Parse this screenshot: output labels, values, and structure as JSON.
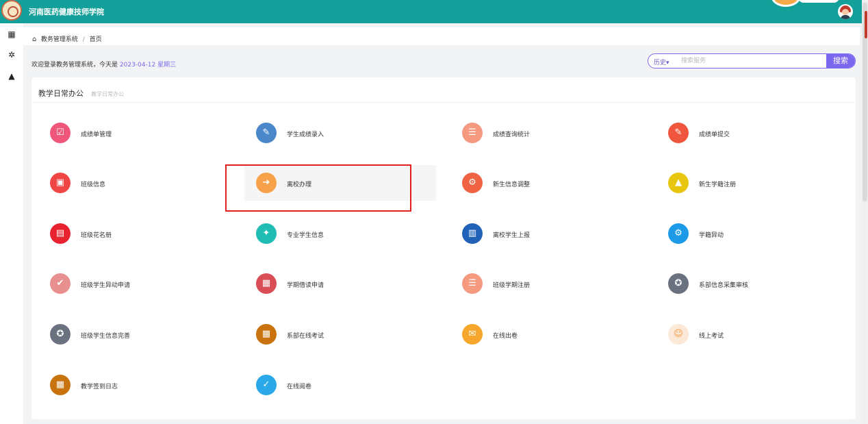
{
  "header": {
    "title": "河南医药健康技师学院"
  },
  "breadcrumb": {
    "root": "教务管理系统",
    "sep": "/",
    "current": "首页"
  },
  "welcome": {
    "text": "欢迎登录教务管理系统，今天是",
    "date": "2023-04-12",
    "weekday": "星期三"
  },
  "search": {
    "history_label": "历史▾",
    "placeholder": "搜索服务",
    "button": "搜索"
  },
  "panel": {
    "title": "教学日常办公",
    "subtitle": "教学日常办公"
  },
  "tiles": [
    {
      "label": "成绩单管理",
      "icon": "checklist-icon",
      "color": "#f0557a"
    },
    {
      "label": "学生成绩录入",
      "icon": "edit-doc-icon",
      "color": "#4b88c9"
    },
    {
      "label": "成绩查询统计",
      "icon": "user-list-icon",
      "color": "#f59a7f"
    },
    {
      "label": "成绩单提交",
      "icon": "edit-doc-icon",
      "color": "#f0553e"
    },
    {
      "label": "班级信息",
      "icon": "id-card-icon",
      "color": "#f04545"
    },
    {
      "label": "离校办理",
      "icon": "user-exit-icon",
      "color": "#f7a24a"
    },
    {
      "label": "新生信息调整",
      "icon": "calendar-settings-icon",
      "color": "#f06244"
    },
    {
      "label": "新生学籍注册",
      "icon": "graduation-icon",
      "color": "#e8c60f"
    },
    {
      "label": "班级花名册",
      "icon": "contact-book-icon",
      "color": "#e8222e"
    },
    {
      "label": "专业学生信息",
      "icon": "student-book-icon",
      "color": "#1fbdb4"
    },
    {
      "label": "离校学生上报",
      "icon": "report-icon",
      "color": "#2062b8"
    },
    {
      "label": "学籍异动",
      "icon": "user-gear-icon",
      "color": "#1c9ae8"
    },
    {
      "label": "班级学生异动申请",
      "icon": "calendar-check-icon",
      "color": "#e89090"
    },
    {
      "label": "学期借读申请",
      "icon": "document-user-icon",
      "color": "#d94e56"
    },
    {
      "label": "班级学期注册",
      "icon": "user-list-icon",
      "color": "#f59a7f"
    },
    {
      "label": "系部信息采集审核",
      "icon": "award-icon",
      "color": "#6a7280"
    },
    {
      "label": "班级学生信息完善",
      "icon": "award-icon",
      "color": "#6a7280"
    },
    {
      "label": "系部在线考试",
      "icon": "exam-board-icon",
      "color": "#c9730e"
    },
    {
      "label": "在线出卷",
      "icon": "chat-doc-icon",
      "color": "#f5a62b"
    },
    {
      "label": "线上考试",
      "icon": "reading-user-icon",
      "color": "#fbe8d6"
    },
    {
      "label": "教学签到日志",
      "icon": "exam-board-icon",
      "color": "#c9730e"
    },
    {
      "label": "在线阅卷",
      "icon": "teacher-check-icon",
      "color": "#2aa8e8"
    }
  ],
  "sidebar": {
    "items": [
      "grid-icon",
      "cubes-icon",
      "graduation-cap-icon"
    ]
  }
}
